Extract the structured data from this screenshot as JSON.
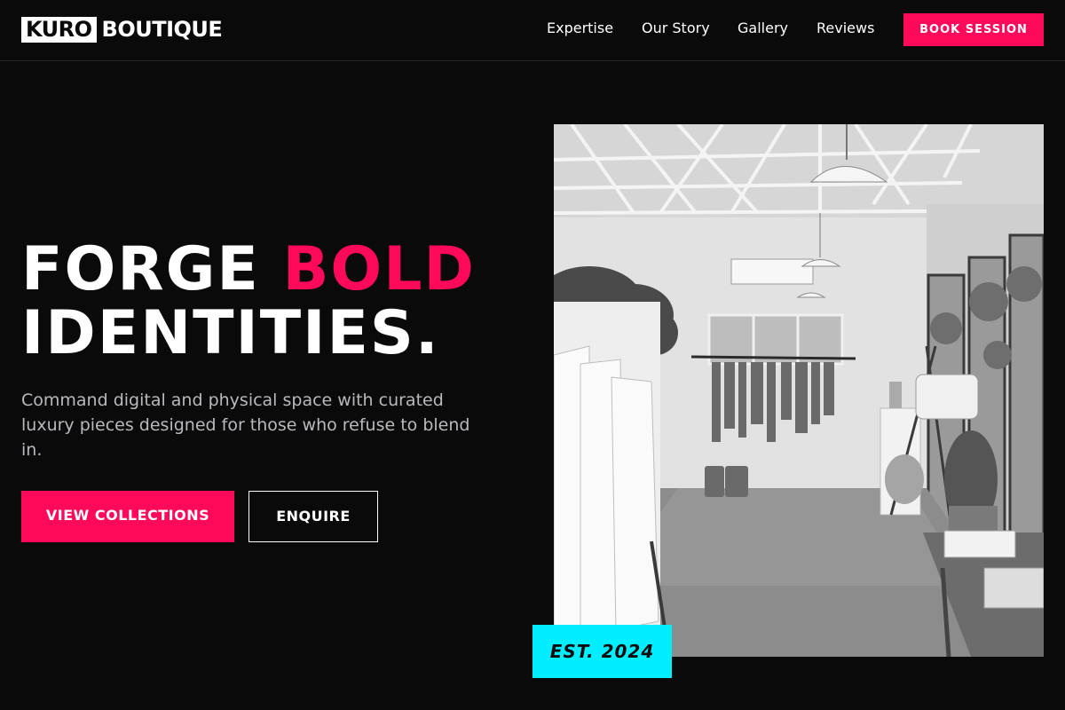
{
  "brand": {
    "logo_box": "KURO",
    "logo_text": "BOUTIQUE"
  },
  "nav": {
    "items": [
      "Expertise",
      "Our Story",
      "Gallery",
      "Reviews"
    ],
    "cta": "BOOK SESSION"
  },
  "hero": {
    "headline_line1_a": "FORGE",
    "headline_line1_accent": "BOLD",
    "headline_line2": "IDENTITIES.",
    "subtext": "Command digital and physical space with curated luxury pieces designed for those who refuse to blend in.",
    "primary_button": "VIEW COLLECTIONS",
    "secondary_button": "ENQUIRE"
  },
  "badge": {
    "text": "EST. 2024"
  },
  "colors": {
    "background": "#0a0a0b",
    "accent": "#ff0a5a",
    "badge": "#00eeff",
    "text": "#ffffff",
    "muted_text": "#b9b9be"
  },
  "image": {
    "content": "grayscale-boutique-interior-photo"
  }
}
